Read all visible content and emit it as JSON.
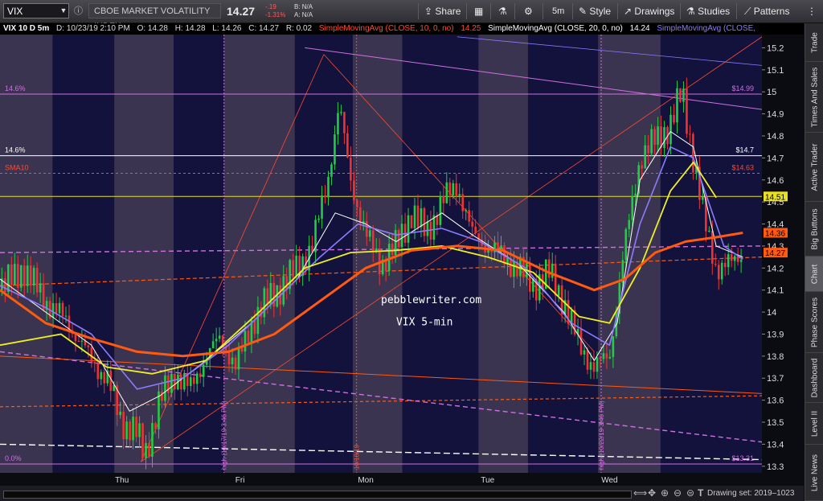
{
  "toolbar": {
    "symbol": "VIX",
    "description": "CBOE MARKET VOLATILITY INDEX",
    "last_price": "14.27",
    "net_change": "-.19",
    "pct_change": "-1.31%",
    "bid": "B: N/A",
    "ask": "A: N/A",
    "share_label": "Share",
    "interval_label": "5m",
    "style_label": "Style",
    "drawings_label": "Drawings",
    "studies_label": "Studies",
    "patterns_label": "Patterns"
  },
  "info_row": {
    "title": "VIX 10 D 5m",
    "date": "D: 10/23/19 2:10 PM",
    "open": "O: 14.28",
    "high": "H: 14.28",
    "low": "L: 14.26",
    "close": "C: 14.27",
    "range": "R: 0.02",
    "study1": "SimpleMovingAvg (CLOSE, 10, 0, no)",
    "study1_value": "14.25",
    "study2": "SimpleMovingAvg (CLOSE, 20, 0, no)",
    "study2_value": "14.24",
    "study3": "SimpleMovingAvg (CLOSE,"
  },
  "sidebar": {
    "tabs": [
      "Trade",
      "Times And Sales",
      "Active Trader",
      "Big Buttons",
      "Chart",
      "Phase Scores",
      "Dashboard",
      "Level II",
      "Live News"
    ],
    "active": "Chart"
  },
  "bottom": {
    "drawing_set": "Drawing set: 2019–1023"
  },
  "colors": {
    "sma10": "#ff4a2e",
    "sma20": "#ffffff",
    "sma50": "#8a7cff",
    "sma100": "#f0f020",
    "sma200": "#ff5a10",
    "fib": "#d070e0",
    "up_candle": "#22cc44",
    "down_candle": "#ee3333"
  },
  "chart_data": {
    "type": "line",
    "title": "VIX 5-min",
    "watermark": "pebblewriter.com",
    "x_sessions": [
      "Thu",
      "Fri",
      "Mon",
      "Tue",
      "Wed"
    ],
    "y_ticks": [
      15.2,
      15.1,
      15.0,
      14.9,
      14.8,
      14.7,
      14.6,
      14.5,
      14.4,
      14.3,
      14.2,
      14.1,
      14.0,
      13.9,
      13.8,
      13.7,
      13.6,
      13.5,
      13.4,
      13.3
    ],
    "ylim": [
      13.27,
      15.26
    ],
    "price_path": [
      [
        0,
        14.1
      ],
      [
        3,
        14.2
      ],
      [
        6,
        14.05
      ],
      [
        9,
        13.95
      ],
      [
        12,
        13.78
      ],
      [
        14,
        13.7
      ],
      [
        16,
        13.5
      ],
      [
        18,
        13.45
      ],
      [
        19,
        13.35
      ],
      [
        21,
        13.6
      ],
      [
        23,
        13.72
      ],
      [
        25,
        13.65
      ],
      [
        27,
        13.8
      ],
      [
        29,
        13.88
      ],
      [
        31,
        13.75
      ],
      [
        33,
        13.95
      ],
      [
        35,
        14.05
      ],
      [
        37,
        14.12
      ],
      [
        39,
        14.2
      ],
      [
        41,
        14.3
      ],
      [
        43,
        14.6
      ],
      [
        44.5,
        14.94
      ],
      [
        46,
        14.6
      ],
      [
        48,
        14.35
      ],
      [
        50,
        14.22
      ],
      [
        52,
        14.3
      ],
      [
        54,
        14.45
      ],
      [
        56,
        14.36
      ],
      [
        58,
        14.5
      ],
      [
        60,
        14.58
      ],
      [
        62,
        14.35
      ],
      [
        64,
        14.3
      ],
      [
        66,
        14.25
      ],
      [
        68,
        14.2
      ],
      [
        70,
        14.12
      ],
      [
        72,
        14.18
      ],
      [
        74,
        14.05
      ],
      [
        76,
        13.85
      ],
      [
        78,
        13.75
      ],
      [
        80,
        13.8
      ],
      [
        82,
        14.3
      ],
      [
        84,
        14.7
      ],
      [
        86,
        14.78
      ],
      [
        88,
        14.85
      ],
      [
        89.5,
        15.0
      ],
      [
        91,
        14.7
      ],
      [
        92.5,
        14.4
      ],
      [
        94,
        14.2
      ],
      [
        96,
        14.22
      ],
      [
        97.5,
        14.27
      ]
    ],
    "series": [
      {
        "name": "SimpleMovingAvg (CLOSE, 10, 0, no)",
        "color": "#ffffff",
        "values": [
          [
            0,
            14.15
          ],
          [
            6,
            14.0
          ],
          [
            12,
            13.85
          ],
          [
            17,
            13.55
          ],
          [
            21,
            13.62
          ],
          [
            27,
            13.78
          ],
          [
            33,
            13.95
          ],
          [
            39,
            14.15
          ],
          [
            44,
            14.45
          ],
          [
            48,
            14.4
          ],
          [
            52,
            14.32
          ],
          [
            58,
            14.45
          ],
          [
            62,
            14.35
          ],
          [
            68,
            14.22
          ],
          [
            74,
            14.0
          ],
          [
            78,
            13.78
          ],
          [
            81,
            13.95
          ],
          [
            84,
            14.6
          ],
          [
            88,
            14.82
          ],
          [
            91,
            14.75
          ],
          [
            94,
            14.3
          ],
          [
            97.5,
            14.25
          ]
        ]
      },
      {
        "name": "SimpleMovingAvg (CLOSE, 20, 0, no)",
        "color": "#8a7cff",
        "values": [
          [
            0,
            14.12
          ],
          [
            6,
            14.02
          ],
          [
            12,
            13.9
          ],
          [
            18,
            13.65
          ],
          [
            24,
            13.7
          ],
          [
            30,
            13.85
          ],
          [
            36,
            14.05
          ],
          [
            42,
            14.25
          ],
          [
            47,
            14.4
          ],
          [
            52,
            14.35
          ],
          [
            58,
            14.38
          ],
          [
            63,
            14.32
          ],
          [
            69,
            14.2
          ],
          [
            75,
            13.95
          ],
          [
            80,
            13.85
          ],
          [
            84,
            14.4
          ],
          [
            88,
            14.75
          ],
          [
            91,
            14.7
          ],
          [
            95,
            14.3
          ],
          [
            97.5,
            14.24
          ]
        ]
      },
      {
        "name": "SimpleMovingAvg (CLOSE,",
        "color": "#f0f020",
        "values": [
          [
            0,
            13.85
          ],
          [
            8,
            13.9
          ],
          [
            14,
            13.75
          ],
          [
            20,
            13.72
          ],
          [
            27,
            13.78
          ],
          [
            34,
            14.0
          ],
          [
            40,
            14.2
          ],
          [
            46,
            14.27
          ],
          [
            52,
            14.28
          ],
          [
            58,
            14.3
          ],
          [
            64,
            14.25
          ],
          [
            70,
            14.18
          ],
          [
            76,
            13.98
          ],
          [
            80,
            13.95
          ],
          [
            84,
            14.2
          ],
          [
            88,
            14.55
          ],
          [
            91,
            14.68
          ],
          [
            94,
            14.52
          ]
        ]
      },
      {
        "name": "SMA10",
        "color": "#ff5a10",
        "values": [
          [
            0,
            14.1
          ],
          [
            6,
            13.95
          ],
          [
            12,
            13.88
          ],
          [
            18,
            13.82
          ],
          [
            24,
            13.8
          ],
          [
            30,
            13.82
          ],
          [
            36,
            13.9
          ],
          [
            42,
            14.05
          ],
          [
            48,
            14.2
          ],
          [
            54,
            14.28
          ],
          [
            60,
            14.3
          ],
          [
            66,
            14.28
          ],
          [
            72,
            14.18
          ],
          [
            78,
            14.1
          ],
          [
            82,
            14.15
          ],
          [
            86,
            14.27
          ],
          [
            90,
            14.32
          ],
          [
            94,
            14.34
          ],
          [
            97.5,
            14.36
          ]
        ]
      }
    ],
    "horizontal_levels": [
      {
        "label_left": "14.6%",
        "label_right": "$14.99",
        "value": 14.99,
        "color": "#d070e0"
      },
      {
        "label_left": "14.6%",
        "label_right": "$14.7",
        "value": 14.71,
        "color": "#ffffff"
      },
      {
        "label_left": "SMA10",
        "label_right": "$14.63",
        "value": 14.63,
        "color": "#ff4a2e"
      },
      {
        "label_right": "14.51",
        "value": 14.525,
        "color": "#e8e020"
      },
      {
        "label_right": "14.36",
        "value": 14.36,
        "color": "#ff5a10"
      },
      {
        "label_right": "14.27",
        "value": 14.27,
        "color": "#ff5a10"
      },
      {
        "label_left": "0.0%",
        "label_right": "$13.31",
        "value": 13.31,
        "color": "#d070e0"
      }
    ],
    "vertical_labels": [
      "high (10/17/19 3:46 PM)",
      "10/18/19",
      "high (10/22/19 3:46 PM)"
    ]
  }
}
